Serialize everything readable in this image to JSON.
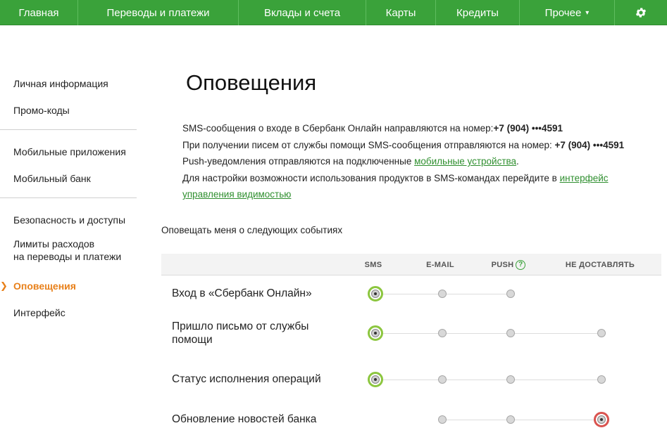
{
  "nav": {
    "items": [
      {
        "label": "Главная",
        "width": 111
      },
      {
        "label": "Переводы и платежи",
        "width": 228
      },
      {
        "label": "Вклады и счета",
        "width": 181
      },
      {
        "label": "Карты",
        "width": 99
      },
      {
        "label": "Кредиты",
        "width": 119
      },
      {
        "label": "Прочее",
        "width": 135,
        "caret": "▾"
      }
    ],
    "settings_icon": "gear-icon"
  },
  "sidebar": {
    "items": [
      {
        "label": "Личная информация"
      },
      {
        "label": "Промо-коды"
      },
      {
        "label": "Мобильные приложения"
      },
      {
        "label": "Мобильный банк"
      },
      {
        "label": "Безопасность и доступы"
      },
      {
        "label_line1": "Лимиты расходов",
        "label_line2": "на переводы и платежи"
      },
      {
        "label": "Оповещения",
        "active": true
      },
      {
        "label": "Интерфейс"
      }
    ]
  },
  "main": {
    "title": "Оповещения",
    "info": {
      "line1_text": "SMS-сообщения о входе в Сбербанк Онлайн направляются на номер:",
      "line1_phone": "+7 (904) •••4591",
      "line2_text": "При получении писем от службы помощи SMS-сообщения отправляются на номер: ",
      "line2_phone": "+7 (904) •••4591",
      "line3_text": "Push-уведомления отправляются на подключенные ",
      "line3_link": "мобильные устройства",
      "line3_end": ".",
      "line4_text": "Для настройки возможности использования продуктов в SMS-командах перейдите в ",
      "line4_link": "интерфейс управления видимостью"
    },
    "events_label": "Оповещать меня о следующих событиях",
    "columns": {
      "sms": "SMS",
      "email": "E-MAIL",
      "push": "PUSH",
      "push_help": "?",
      "none": "НЕ ДОСТАВЛЯТЬ"
    },
    "rows": [
      {
        "label_line1": "Вход в «Сбербанк Онлайн»",
        "label_line2": "",
        "selected": "sms",
        "options": [
          "sms",
          "email",
          "push"
        ]
      },
      {
        "label_line1": "Пришло письмо от службы",
        "label_line2": "помощи",
        "selected": "sms",
        "options": [
          "sms",
          "email",
          "push",
          "none"
        ]
      },
      {
        "label_line1": "Статус исполнения операций",
        "label_line2": "",
        "selected": "sms",
        "options": [
          "sms",
          "email",
          "push",
          "none"
        ]
      },
      {
        "label_line1": "Обновление новостей банка",
        "label_line2": "",
        "selected": "none",
        "options": [
          "email",
          "push",
          "none"
        ]
      }
    ]
  },
  "colors": {
    "nav_bg": "#3aa23a",
    "active": "#e8801a",
    "link": "#2f8f2f",
    "selected_ring": "#8cc63f",
    "selected_ring_off": "#d9534f"
  }
}
